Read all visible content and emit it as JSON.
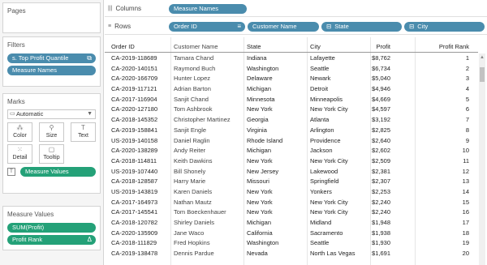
{
  "left": {
    "pages_title": "Pages",
    "filters_title": "Filters",
    "filters": [
      {
        "label": "s. Top Profit Quantile",
        "icon": "⧉"
      },
      {
        "label": "Measure Names",
        "icon": ""
      }
    ],
    "marks_title": "Marks",
    "marks_type": "Automatic",
    "mark_buttons": [
      {
        "label": "Color",
        "icon": "⁂"
      },
      {
        "label": "Size",
        "icon": "⚲"
      },
      {
        "label": "Text",
        "icon": "T"
      },
      {
        "label": "Detail",
        "icon": "⁙"
      },
      {
        "label": "Tooltip",
        "icon": "▢"
      }
    ],
    "measure_values_pill": "Measure Values",
    "measure_values_title": "Measure Values",
    "measure_values": [
      {
        "label": "SUM(Profit)",
        "icon": ""
      },
      {
        "label": "Profit Rank",
        "icon": "Δ"
      }
    ]
  },
  "shelves": {
    "columns_label": "Columns",
    "columns_pill": "Measure Names",
    "rows_label": "Rows",
    "rows_pills": [
      {
        "label": "Order ID",
        "icon": "≡"
      },
      {
        "label": "Customer Name",
        "icon": ""
      },
      {
        "label": "State",
        "icon": "⊟"
      },
      {
        "label": "City",
        "icon": "⊟"
      }
    ]
  },
  "table": {
    "headers": {
      "order": "Order ID",
      "customer": "Customer Name",
      "state": "State",
      "city": "City",
      "profit": "Profit",
      "rank": "Profit Rank"
    },
    "rows": [
      {
        "order": "CA-2019-118689",
        "customer": "Tamara Chand",
        "state": "Indiana",
        "city": "Lafayette",
        "profit": "$8,762",
        "rank": "1"
      },
      {
        "order": "CA-2020-140151",
        "customer": "Raymond Buch",
        "state": "Washington",
        "city": "Seattle",
        "profit": "$6,734",
        "rank": "2"
      },
      {
        "order": "CA-2020-166709",
        "customer": "Hunter Lopez",
        "state": "Delaware",
        "city": "Newark",
        "profit": "$5,040",
        "rank": "3"
      },
      {
        "order": "CA-2019-117121",
        "customer": "Adrian Barton",
        "state": "Michigan",
        "city": "Detroit",
        "profit": "$4,946",
        "rank": "4"
      },
      {
        "order": "CA-2017-116904",
        "customer": "Sanjit Chand",
        "state": "Minnesota",
        "city": "Minneapolis",
        "profit": "$4,669",
        "rank": "5"
      },
      {
        "order": "CA-2020-127180",
        "customer": "Tom Ashbrook",
        "state": "New York",
        "city": "New York City",
        "profit": "$4,597",
        "rank": "6"
      },
      {
        "order": "CA-2018-145352",
        "customer": "Christopher Martinez",
        "state": "Georgia",
        "city": "Atlanta",
        "profit": "$3,192",
        "rank": "7"
      },
      {
        "order": "CA-2019-158841",
        "customer": "Sanjit Engle",
        "state": "Virginia",
        "city": "Arlington",
        "profit": "$2,825",
        "rank": "8"
      },
      {
        "order": "US-2019-140158",
        "customer": "Daniel Raglin",
        "state": "Rhode Island",
        "city": "Providence",
        "profit": "$2,640",
        "rank": "9"
      },
      {
        "order": "CA-2020-138289",
        "customer": "Andy Reiter",
        "state": "Michigan",
        "city": "Jackson",
        "profit": "$2,602",
        "rank": "10"
      },
      {
        "order": "CA-2018-114811",
        "customer": "Keith Dawkins",
        "state": "New York",
        "city": "New York City",
        "profit": "$2,509",
        "rank": "11"
      },
      {
        "order": "US-2019-107440",
        "customer": "Bill Shonely",
        "state": "New Jersey",
        "city": "Lakewood",
        "profit": "$2,381",
        "rank": "12"
      },
      {
        "order": "CA-2018-128587",
        "customer": "Harry Marie",
        "state": "Missouri",
        "city": "Springfield",
        "profit": "$2,307",
        "rank": "13"
      },
      {
        "order": "US-2019-143819",
        "customer": "Karen Daniels",
        "state": "New York",
        "city": "Yonkers",
        "profit": "$2,253",
        "rank": "14"
      },
      {
        "order": "CA-2017-164973",
        "customer": "Nathan Mautz",
        "state": "New York",
        "city": "New York City",
        "profit": "$2,240",
        "rank": "15"
      },
      {
        "order": "CA-2017-145541",
        "customer": "Tom Boeckenhauer",
        "state": "New York",
        "city": "New York City",
        "profit": "$2,240",
        "rank": "16"
      },
      {
        "order": "CA-2018-120782",
        "customer": "Shirley Daniels",
        "state": "Michigan",
        "city": "Midland",
        "profit": "$1,948",
        "rank": "17"
      },
      {
        "order": "CA-2020-135909",
        "customer": "Jane Waco",
        "state": "California",
        "city": "Sacramento",
        "profit": "$1,938",
        "rank": "18"
      },
      {
        "order": "CA-2018-111829",
        "customer": "Fred Hopkins",
        "state": "Washington",
        "city": "Seattle",
        "profit": "$1,930",
        "rank": "19"
      },
      {
        "order": "CA-2019-138478",
        "customer": "Dennis Pardue",
        "state": "Nevada",
        "city": "North Las Vegas",
        "profit": "$1,691",
        "rank": "20"
      }
    ]
  },
  "colors": {
    "dimension_pill": "#4a8cad",
    "measure_pill": "#24a178"
  }
}
